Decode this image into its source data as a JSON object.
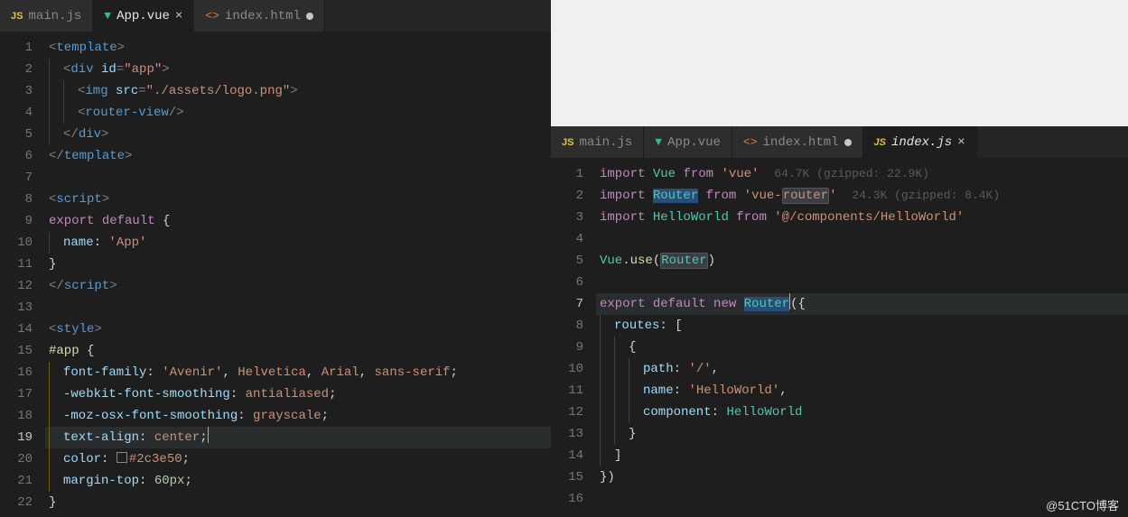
{
  "watermark": "@51CTO博客",
  "left": {
    "tabs": [
      {
        "icon": "js",
        "label": "main.js",
        "active": false,
        "dirty": false,
        "close": false
      },
      {
        "icon": "vue",
        "label": "App.vue",
        "active": true,
        "dirty": false,
        "close": true
      },
      {
        "icon": "html",
        "label": "index.html",
        "active": false,
        "dirty": true,
        "close": false
      }
    ],
    "cursor_line": 19,
    "lines": [
      {
        "n": 1,
        "html": "<span class='c-punct'>&lt;</span><span class='c-tag'>template</span><span class='c-punct'>&gt;</span>"
      },
      {
        "n": 2,
        "indent": 1,
        "html": "<span class='c-punct'>&lt;</span><span class='c-tag'>div</span> <span class='c-attr'>id</span><span class='c-punct'>=</span><span class='c-str'>\"app\"</span><span class='c-punct'>&gt;</span>"
      },
      {
        "n": 3,
        "indent": 2,
        "html": "<span class='c-punct'>&lt;</span><span class='c-tag'>img</span> <span class='c-attr'>src</span><span class='c-punct'>=</span><span class='c-str'>\"./assets/logo.png\"</span><span class='c-punct'>&gt;</span>"
      },
      {
        "n": 4,
        "indent": 2,
        "html": "<span class='c-punct'>&lt;</span><span class='c-tag'>router-view</span><span class='c-punct'>/&gt;</span>"
      },
      {
        "n": 5,
        "indent": 1,
        "html": "<span class='c-punct'>&lt;/</span><span class='c-tag'>div</span><span class='c-punct'>&gt;</span>"
      },
      {
        "n": 6,
        "html": "<span class='c-punct'>&lt;/</span><span class='c-tag'>template</span><span class='c-punct'>&gt;</span>"
      },
      {
        "n": 7,
        "html": ""
      },
      {
        "n": 8,
        "html": "<span class='c-punct'>&lt;</span><span class='c-tag'>script</span><span class='c-punct'>&gt;</span>"
      },
      {
        "n": 9,
        "html": "<span class='c-kw'>export</span> <span class='c-kw'>default</span> <span class='c-brace'>{</span>"
      },
      {
        "n": 10,
        "indent": 1,
        "html": "<span class='c-id'>name</span>: <span class='c-str'>'App'</span>"
      },
      {
        "n": 11,
        "html": "<span class='c-brace'>}</span>"
      },
      {
        "n": 12,
        "html": "<span class='c-punct'>&lt;/</span><span class='c-tag'>script</span><span class='c-punct'>&gt;</span>"
      },
      {
        "n": 13,
        "html": ""
      },
      {
        "n": 14,
        "html": "<span class='c-punct'>&lt;</span><span class='c-tag'>style</span><span class='c-punct'>&gt;</span>"
      },
      {
        "n": 15,
        "html": "<span class='c-yel'>#app</span> <span class='c-brace'>{</span>"
      },
      {
        "n": 16,
        "indent": 1,
        "iy": true,
        "html": "<span class='c-prop'>font-family</span>: <span class='c-val'>'Avenir'</span>, <span class='c-val'>Helvetica</span>, <span class='c-val'>Arial</span>, <span class='c-val'>sans-serif</span>;"
      },
      {
        "n": 17,
        "indent": 1,
        "iy": true,
        "html": "<span class='c-prop'>-webkit-font-smoothing</span>: <span class='c-val'>antialiased</span>;"
      },
      {
        "n": 18,
        "indent": 1,
        "iy": true,
        "html": "<span class='c-prop'>-moz-osx-font-smoothing</span>: <span class='c-val'>grayscale</span>;"
      },
      {
        "n": 19,
        "indent": 1,
        "iy": true,
        "hl": true,
        "html": "<span class='c-prop'>text-align</span>: <span class='c-val'>center</span>;<span class='cursor'></span>"
      },
      {
        "n": 20,
        "indent": 1,
        "iy": true,
        "html": "<span class='c-prop'>color</span>: <span class='colorbox'></span><span class='c-val'>#2c3e50</span>;"
      },
      {
        "n": 21,
        "indent": 1,
        "iy": true,
        "html": "<span class='c-prop'>margin-top</span>: <span class='c-num'>60px</span>;"
      },
      {
        "n": 22,
        "html": "<span class='c-brace'>}</span>"
      }
    ]
  },
  "right": {
    "tabs": [
      {
        "icon": "js",
        "label": "main.js",
        "active": false,
        "dirty": false,
        "close": false
      },
      {
        "icon": "vue",
        "label": "App.vue",
        "active": false,
        "dirty": false,
        "close": false
      },
      {
        "icon": "html",
        "label": "index.html",
        "active": false,
        "dirty": true,
        "close": false
      },
      {
        "icon": "js",
        "label": "index.js",
        "active": true,
        "dirty": false,
        "close": true,
        "italic": true
      }
    ],
    "cursor_line": 7,
    "lines": [
      {
        "n": 1,
        "html": "<span class='c-kw'>import</span> <span class='c-var'>Vue</span> <span class='c-kw'>from</span> <span class='c-str'>'vue'</span>  <span class='c-hint'>64.7K (gzipped: 22.9K)</span>"
      },
      {
        "n": 2,
        "html": "<span class='c-kw'>import</span> <span class='sel'><span class='c-var'>Router</span></span> <span class='c-kw'>from</span> <span class='c-str'>'vue-<span class='hlw'>router</span>'</span>  <span class='c-hint'>24.3K (gzipped: 8.4K)</span>"
      },
      {
        "n": 3,
        "html": "<span class='c-kw'>import</span> <span class='c-var'>HelloWorld</span> <span class='c-kw'>from</span> <span class='c-str'>'@/components/HelloWorld'</span>"
      },
      {
        "n": 4,
        "html": ""
      },
      {
        "n": 5,
        "html": "<span class='c-var'>Vue</span>.<span class='c-fn'>use</span>(<span class='hlw'><span class='c-var'>Router</span></span>)"
      },
      {
        "n": 6,
        "html": ""
      },
      {
        "n": 7,
        "hl": true,
        "html": "<span class='c-kw'>export</span> <span class='c-kw'>default</span> <span class='c-kw'>new</span> <span class='sel'><span class='c-var'>Router</span></span><span class='cursor'></span>(<span class='c-brace'>{</span>"
      },
      {
        "n": 8,
        "indent": 1,
        "html": "<span class='c-id'>routes</span>: ["
      },
      {
        "n": 9,
        "indent": 2,
        "html": "<span class='c-brace'>{</span>"
      },
      {
        "n": 10,
        "indent": 3,
        "html": "<span class='c-id'>path</span>: <span class='c-str'>'/'</span>,"
      },
      {
        "n": 11,
        "indent": 3,
        "html": "<span class='c-id'>name</span>: <span class='c-str'>'HelloWorld'</span>,"
      },
      {
        "n": 12,
        "indent": 3,
        "html": "<span class='c-id'>component</span>: <span class='c-var'>HelloWorld</span>"
      },
      {
        "n": 13,
        "indent": 2,
        "html": "<span class='c-brace'>}</span>"
      },
      {
        "n": 14,
        "indent": 1,
        "html": "]"
      },
      {
        "n": 15,
        "html": "<span class='c-brace'>}</span>)"
      },
      {
        "n": 16,
        "html": ""
      }
    ]
  }
}
